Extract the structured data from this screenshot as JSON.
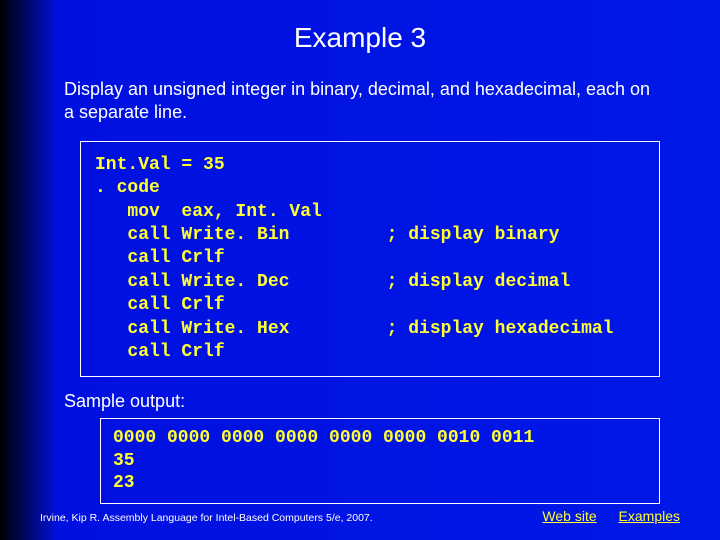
{
  "title": "Example 3",
  "description": "Display an unsigned integer in binary, decimal, and hexadecimal, each on a separate line.",
  "code": "Int.Val = 35\n. code\n   mov  eax, Int. Val\n   call Write. Bin         ; display binary\n   call Crlf\n   call Write. Dec         ; display decimal\n   call Crlf\n   call Write. Hex         ; display hexadecimal\n   call Crlf",
  "sample_label": "Sample output:",
  "output": "0000 0000 0000 0000 0000 0000 0010 0011\n35\n23",
  "footer": {
    "credit": "Irvine, Kip R. Assembly Language for Intel-Based Computers 5/e, 2007.",
    "link_web": "Web site",
    "link_examples": "Examples"
  }
}
